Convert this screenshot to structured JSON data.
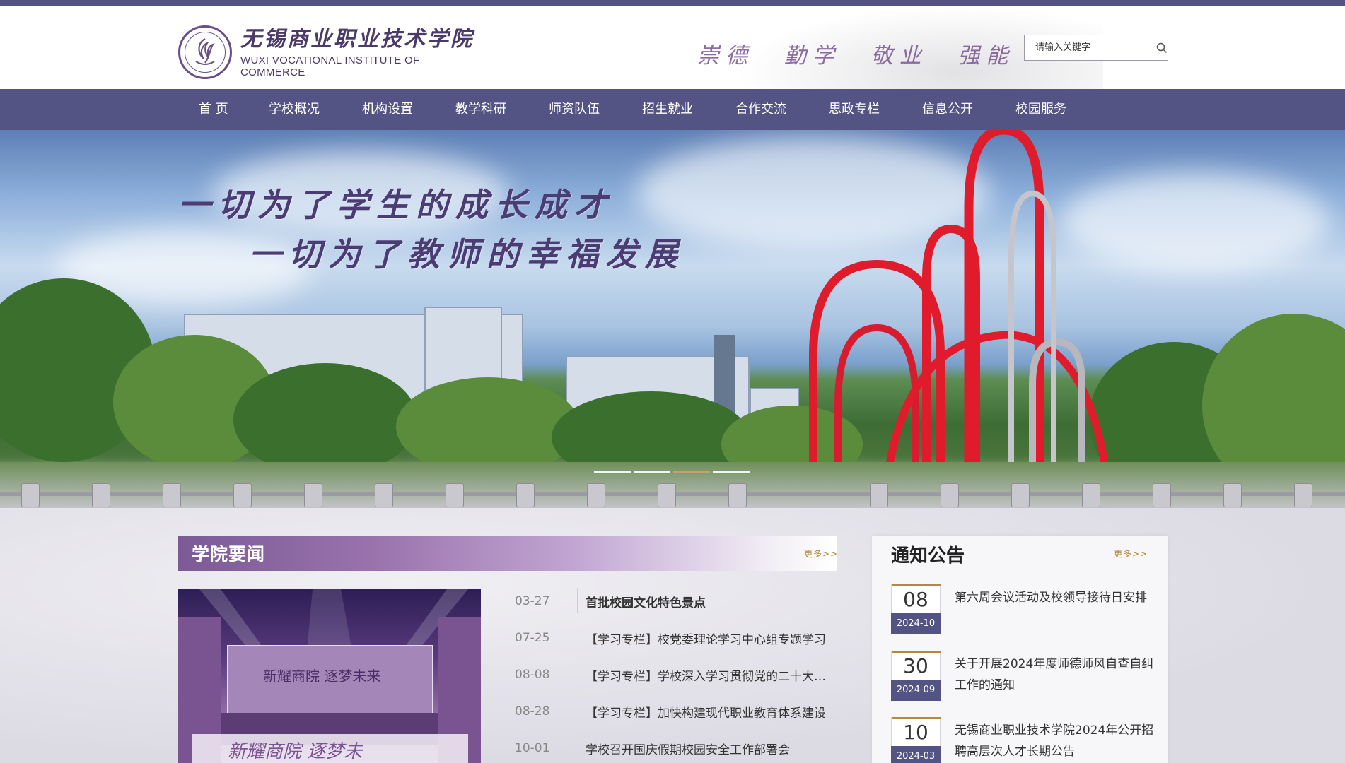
{
  "header": {
    "school_name_cn": "无锡商业职业技术学院",
    "school_name_en": "WUXI VOCATIONAL INSTITUTE OF COMMERCE",
    "motto": "崇德 勤学 敬业 强能",
    "search_placeholder": "请输入关键字"
  },
  "nav": {
    "items": [
      {
        "label": "首 页"
      },
      {
        "label": "学校概况"
      },
      {
        "label": "机构设置"
      },
      {
        "label": "教学科研"
      },
      {
        "label": "师资队伍"
      },
      {
        "label": "招生就业"
      },
      {
        "label": "合作交流"
      },
      {
        "label": "思政专栏"
      },
      {
        "label": "信息公开"
      },
      {
        "label": "校园服务"
      }
    ]
  },
  "banner": {
    "slogan_line1": "一切为了学生的成长成才",
    "slogan_line2": "一切为了教师的幸福发展",
    "slide_count": 4,
    "active_slide": 3
  },
  "news": {
    "title": "学院要闻",
    "more": "更多>>",
    "items": [
      {
        "date": "03-27",
        "title": "首批校园文化特色景点"
      },
      {
        "date": "07-25",
        "title": "【学习专栏】校党委理论学习中心组专题学习"
      },
      {
        "date": "08-08",
        "title": "【学习专栏】学校深入学习贯彻党的二十大精神"
      },
      {
        "date": "08-28",
        "title": "【学习专栏】加快构建现代职业教育体系建设"
      },
      {
        "date": "10-01",
        "title": "学校召开国庆假期校园安全工作部署会"
      }
    ]
  },
  "notice": {
    "title": "通知公告",
    "more": "更多>>",
    "items": [
      {
        "day": "08",
        "ym": "2024-10",
        "title": "第六周会议活动及校领导接待日安排"
      },
      {
        "day": "30",
        "ym": "2024-09",
        "title": "关于开展2024年度师德师风自查自纠工作的通知"
      },
      {
        "day": "10",
        "ym": "2024-03",
        "title": "无锡商业职业技术学院2024年公开招聘高层次人才长期公告"
      }
    ]
  },
  "colors": {
    "nav_bg": "#535484",
    "accent_gold": "#b28a3e",
    "brand_purple": "#4b3969"
  }
}
